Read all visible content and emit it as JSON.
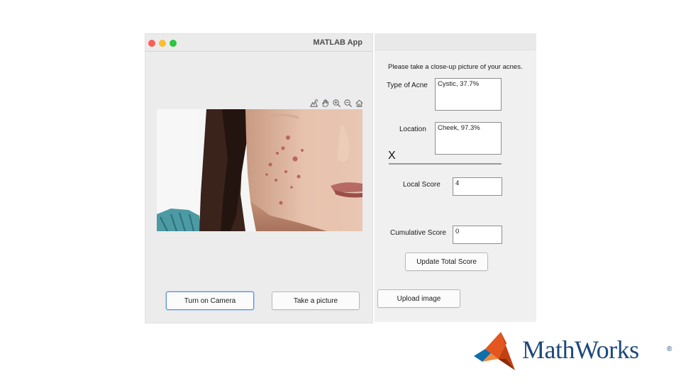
{
  "window": {
    "title": "MATLAB App"
  },
  "left_panel": {
    "buttons": {
      "turn_on_camera": "Turn on Camera",
      "take_picture": "Take a picture"
    },
    "axes_toolbar": [
      "export-icon",
      "pan-hand-icon",
      "zoom-in-icon",
      "zoom-out-icon",
      "home-icon"
    ]
  },
  "right_panel": {
    "instruction": "Please take a close-up picture of your acnes.",
    "type_of_acne": {
      "label": "Type of Acne",
      "value": "Cystic, 37.7%"
    },
    "location": {
      "label": "Location",
      "value": "Cheek, 97.3%"
    },
    "close_mark": "X",
    "local_score": {
      "label": "Local Score",
      "value": "4"
    },
    "cumulative_score": {
      "label": "Cumulative Score",
      "value": "0"
    },
    "update_button": "Update Total Score",
    "upload_button": "Upload image"
  },
  "branding": {
    "name": "MathWorks",
    "registered": "®"
  },
  "colors": {
    "traffic_red": "#fd5f57",
    "traffic_yellow": "#febc2e",
    "traffic_green": "#28c840",
    "focus_blue": "#5b8fd6",
    "logo_blue": "#1e4a7a"
  }
}
